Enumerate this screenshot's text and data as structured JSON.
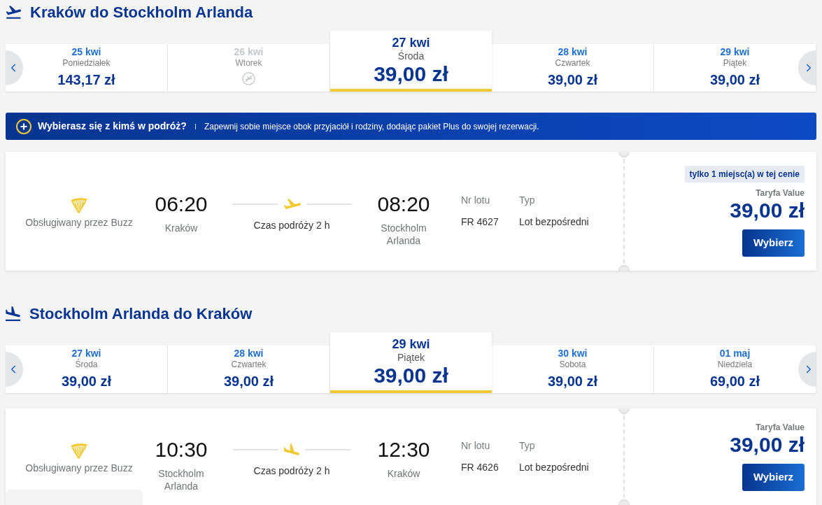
{
  "sections": [
    {
      "kind": "outbound",
      "title": "Kraków do Stockholm Arlanda",
      "dates": [
        {
          "date": "25 kwi",
          "weekday": "Poniedziałek",
          "price": "143,17 zł",
          "available": true,
          "selected": false
        },
        {
          "date": "26 kwi",
          "weekday": "Wtorek",
          "available": false,
          "selected": false
        },
        {
          "date": "27 kwi",
          "weekday": "Środa",
          "price": "39,00 zł",
          "available": true,
          "selected": true
        },
        {
          "date": "28 kwi",
          "weekday": "Czwartek",
          "price": "39,00 zł",
          "available": true,
          "selected": false
        },
        {
          "date": "29 kwi",
          "weekday": "Piątek",
          "price": "39,00 zł",
          "available": true,
          "selected": false
        }
      ],
      "banner": {
        "heading": "Wybierasz się z kimś w podróż?",
        "text": "Zapewnij sobie miejsce obok przyjaciół i rodziny, dodając pakiet Plus do swojej rezerwacji."
      },
      "flights": [
        {
          "operator": "Obsługiwany przez Buzz",
          "departure_time": "06:20",
          "departure_city": "Kraków",
          "duration": "Czas podróży 2 h",
          "arrival_time": "08:20",
          "arrival_city": "Stockholm Arlanda",
          "flight_number_label": "Nr lotu",
          "flight_number": "FR 4627",
          "type_label": "Typ",
          "type": "Lot bezpośredni",
          "badge": "tylko 1 miejsc(a) w tej cenie",
          "fare": "Taryfa Value",
          "price": "39,00 zł",
          "button": "Wybierz"
        }
      ]
    },
    {
      "kind": "return",
      "title": "Stockholm Arlanda do Kraków",
      "dates": [
        {
          "date": "27 kwi",
          "weekday": "Środa",
          "price": "39,00 zł",
          "available": true,
          "selected": false
        },
        {
          "date": "28 kwi",
          "weekday": "Czwartek",
          "price": "39,00 zł",
          "available": true,
          "selected": false
        },
        {
          "date": "29 kwi",
          "weekday": "Piątek",
          "price": "39,00 zł",
          "available": true,
          "selected": true
        },
        {
          "date": "30 kwi",
          "weekday": "Sobota",
          "price": "39,00 zł",
          "available": true,
          "selected": false
        },
        {
          "date": "01 maj",
          "weekday": "Niedziela",
          "price": "69,00 zł",
          "available": true,
          "selected": false
        }
      ],
      "flights": [
        {
          "operator": "Obsługiwany przez Buzz",
          "departure_time": "10:30",
          "departure_city": "Stockholm Arlanda",
          "duration": "Czas podróży 2 h",
          "arrival_time": "12:30",
          "arrival_city": "Kraków",
          "flight_number_label": "Nr lotu",
          "flight_number": "FR 4626",
          "type_label": "Typ",
          "type": "Lot bezpośredni",
          "fare": "Taryfa Value",
          "price": "39,00 zł",
          "button": "Wybierz"
        }
      ]
    }
  ]
}
